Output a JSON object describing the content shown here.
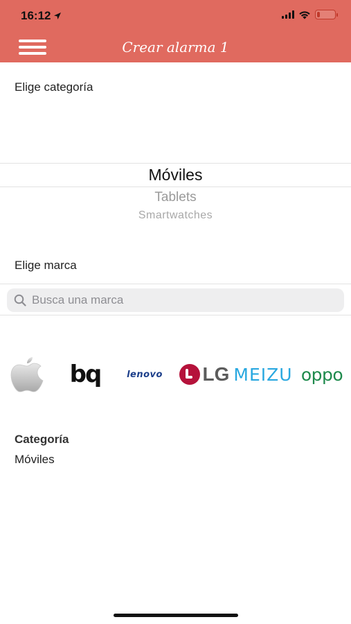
{
  "status_bar": {
    "time": "16:12",
    "location_icon": "location-arrow-icon",
    "battery_color": "#c0392b",
    "battery_level": 0.15
  },
  "header": {
    "title": "Crear alarma 1",
    "background": "#e06a5f",
    "menu_icon": "hamburger-menu-icon"
  },
  "category": {
    "label": "Elige categoría",
    "options": [
      "Móviles",
      "Tablets",
      "Smartwatches"
    ],
    "selected": "Móviles"
  },
  "brand": {
    "label": "Elige marca",
    "search_placeholder": "Busca una marca",
    "search_value": "",
    "logos": [
      {
        "name": "apple",
        "text": ""
      },
      {
        "name": "bq",
        "text": "bq"
      },
      {
        "name": "lenovo",
        "text": "lenovo"
      },
      {
        "name": "lg",
        "text": "LG"
      },
      {
        "name": "meizu",
        "text": "MEIZU"
      },
      {
        "name": "oppo",
        "text": "oppo"
      }
    ]
  },
  "summary": {
    "title": "Categoría",
    "value": "Móviles"
  }
}
